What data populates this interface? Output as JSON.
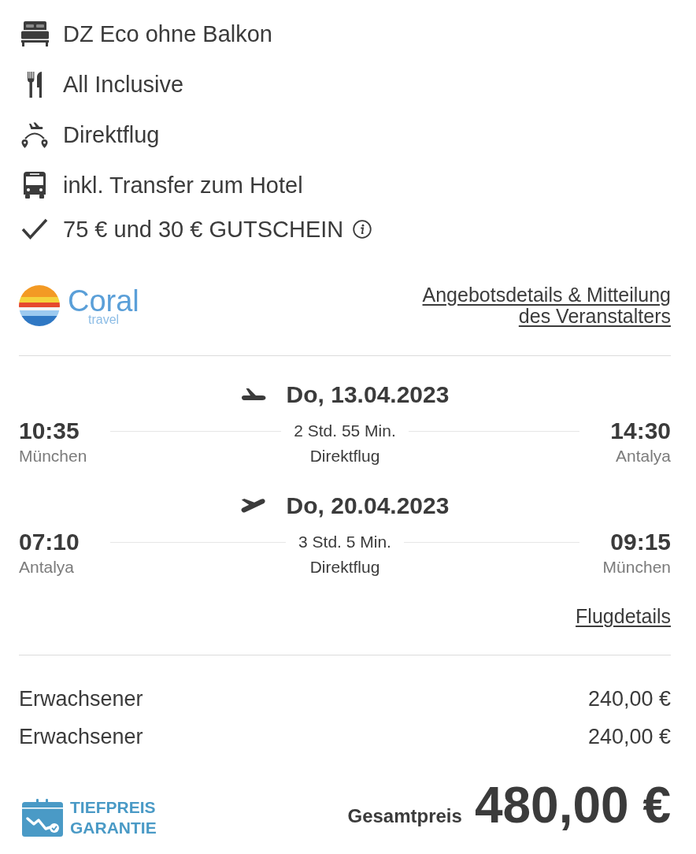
{
  "features": [
    {
      "kind": "bed",
      "text": "DZ Eco ohne Balkon",
      "info": false
    },
    {
      "kind": "meal",
      "text": "All Inclusive",
      "info": false
    },
    {
      "kind": "flight",
      "text": "Direktflug",
      "info": false
    },
    {
      "kind": "transfer",
      "text": "inkl. Transfer zum Hotel",
      "info": false
    },
    {
      "kind": "voucher",
      "text": "75 € und 30 € GUTSCHEIN",
      "info": true
    }
  ],
  "operator": {
    "logo_name": "Coral",
    "logo_tagline": "travel",
    "details_link": "Angebotsdetails & Mitteilung des Veranstalters"
  },
  "flights": [
    {
      "kind": "outbound",
      "date": "Do, 13.04.2023",
      "departure_time": "10:35",
      "departure_city": "München",
      "duration": "2 Std. 55 Min.",
      "flight_type": "Direktflug",
      "arrival_time": "14:30",
      "arrival_city": "Antalya"
    },
    {
      "kind": "return",
      "date": "Do, 20.04.2023",
      "departure_time": "07:10",
      "departure_city": "Antalya",
      "duration": "3 Std. 5 Min.",
      "flight_type": "Direktflug",
      "arrival_time": "09:15",
      "arrival_city": "München"
    }
  ],
  "flight_details_link": "Flugdetails",
  "travellers": [
    {
      "label": "Erwachsener",
      "price": "240,00 €"
    },
    {
      "label": "Erwachsener",
      "price": "240,00 €"
    }
  ],
  "guarantee": {
    "text": "TIEFPREIS GARANTIE"
  },
  "total": {
    "label": "Gesamtpreis",
    "amount": "480,00 €"
  }
}
